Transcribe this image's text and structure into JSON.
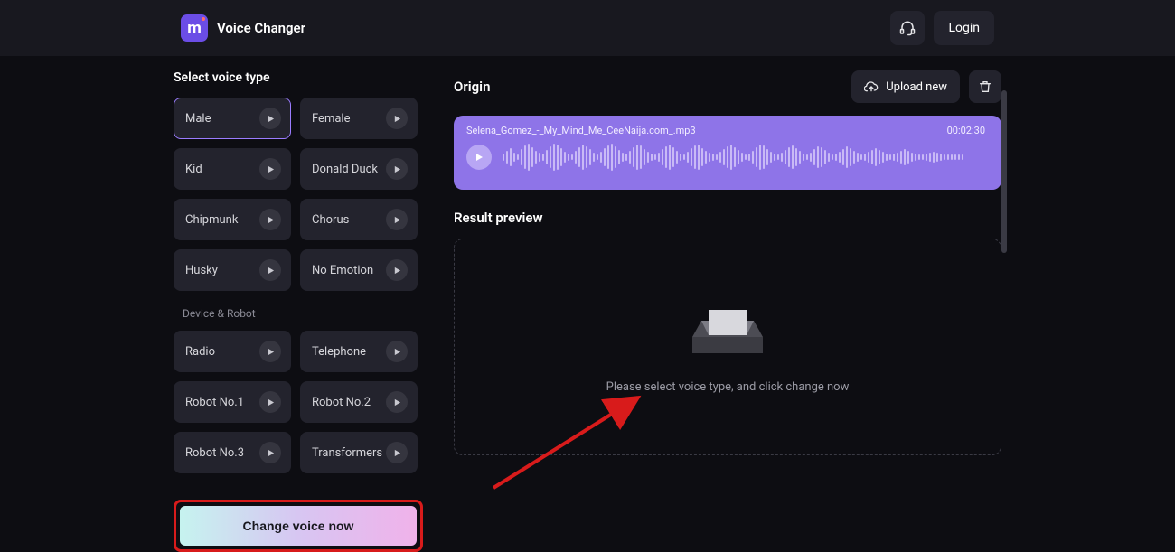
{
  "app": {
    "title": "Voice Changer"
  },
  "topbar": {
    "login_label": "Login"
  },
  "sidebar": {
    "title": "Select voice type",
    "voices": [
      {
        "label": "Male",
        "selected": true
      },
      {
        "label": "Female"
      },
      {
        "label": "Kid"
      },
      {
        "label": "Donald Duck"
      },
      {
        "label": "Chipmunk"
      },
      {
        "label": "Chorus"
      },
      {
        "label": "Husky"
      },
      {
        "label": "No Emotion"
      }
    ],
    "subsection": "Device & Robot",
    "device_voices": [
      {
        "label": "Radio"
      },
      {
        "label": "Telephone"
      },
      {
        "label": "Robot No.1"
      },
      {
        "label": "Robot No.2"
      },
      {
        "label": "Robot No.3"
      },
      {
        "label": "Transformers"
      }
    ],
    "change_label": "Change voice now"
  },
  "content": {
    "origin_title": "Origin",
    "upload_label": "Upload new",
    "origin_file": "Selena_Gomez_-_My_Mind_Me_CeeNaija.com_.mp3",
    "origin_duration": "00:02:30",
    "result_title": "Result preview",
    "result_placeholder": "Please select voice type, and click change now"
  }
}
